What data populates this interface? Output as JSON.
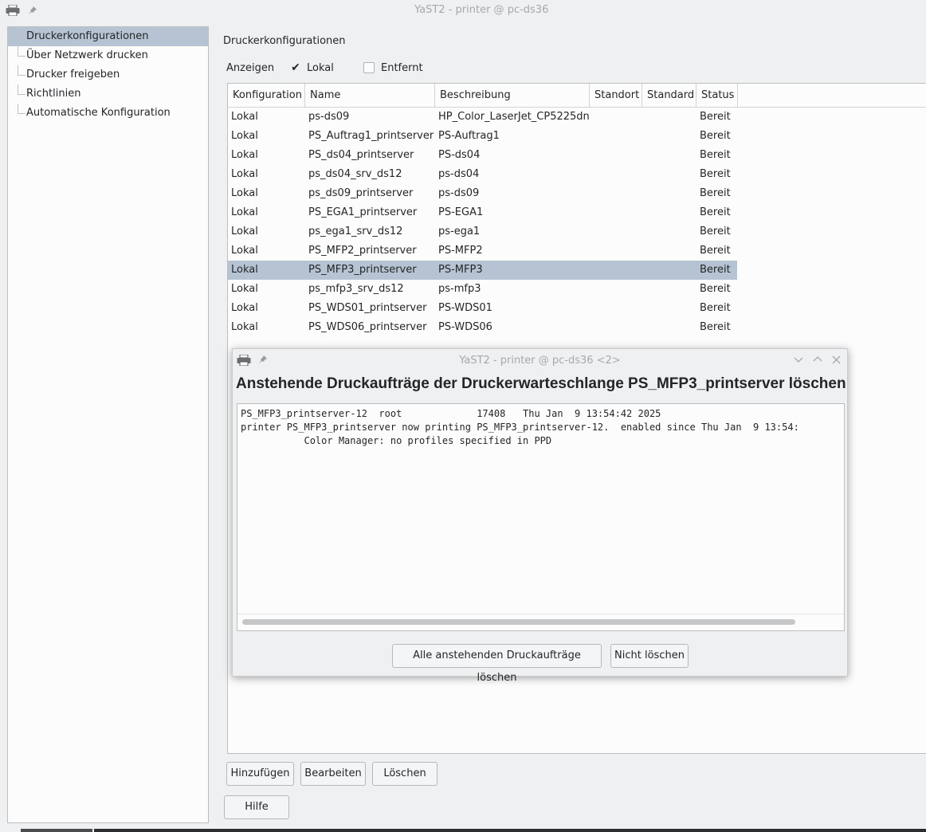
{
  "window": {
    "title": "YaST2 - printer @ pc-ds36"
  },
  "sidebar": {
    "items": [
      {
        "label": "Druckerkonfigurationen",
        "selected": true
      },
      {
        "label": "Über Netzwerk drucken",
        "selected": false
      },
      {
        "label": "Drucker freigeben",
        "selected": false
      },
      {
        "label": "Richtlinien",
        "selected": false
      },
      {
        "label": "Automatische Konfiguration",
        "selected": false
      }
    ]
  },
  "main": {
    "heading": "Druckerkonfigurationen",
    "show_label": "Anzeigen",
    "filter_local": {
      "label": "Lokal",
      "checked": true
    },
    "filter_remote": {
      "label": "Entfernt",
      "checked": false
    },
    "columns": [
      "Konfiguration",
      "Name",
      "Beschreibung",
      "Standort",
      "Standard",
      "Status"
    ],
    "rows": [
      [
        "Lokal",
        "ps-ds09",
        "HP_Color_LaserJet_CP5225dn",
        "",
        "",
        "Bereit"
      ],
      [
        "Lokal",
        "PS_Auftrag1_printserver",
        "PS-Auftrag1",
        "",
        "",
        "Bereit"
      ],
      [
        "Lokal",
        "PS_ds04_printserver",
        "PS-ds04",
        "",
        "",
        "Bereit"
      ],
      [
        "Lokal",
        "ps_ds04_srv_ds12",
        "ps-ds04",
        "",
        "",
        "Bereit"
      ],
      [
        "Lokal",
        "ps_ds09_printserver",
        "ps-ds09",
        "",
        "",
        "Bereit"
      ],
      [
        "Lokal",
        "PS_EGA1_printserver",
        "PS-EGA1",
        "",
        "",
        "Bereit"
      ],
      [
        "Lokal",
        "ps_ega1_srv_ds12",
        "ps-ega1",
        "",
        "",
        "Bereit"
      ],
      [
        "Lokal",
        "PS_MFP2_printserver",
        "PS-MFP2",
        "",
        "",
        "Bereit"
      ],
      [
        "Lokal",
        "PS_MFP3_printserver",
        "PS-MFP3",
        "",
        "",
        "Bereit"
      ],
      [
        "Lokal",
        "ps_mfp3_srv_ds12",
        "ps-mfp3",
        "",
        "",
        "Bereit"
      ],
      [
        "Lokal",
        "PS_WDS01_printserver",
        "PS-WDS01",
        "",
        "",
        "Bereit"
      ],
      [
        "Lokal",
        "PS_WDS06_printserver",
        "PS-WDS06",
        "",
        "",
        "Bereit"
      ]
    ],
    "selected_row": 8,
    "buttons": {
      "add": "Hinzufügen",
      "edit": "Bearbeiten",
      "delete": "Löschen",
      "help": "Hilfe"
    }
  },
  "dialog": {
    "title": "YaST2 - printer @ pc-ds36 <2>",
    "heading": "Anstehende Druckaufträge der Druckerwarteschlange PS_MFP3_printserver löschen",
    "log_lines": [
      "PS_MFP3_printserver-12  root             17408   Thu Jan  9 13:54:42 2025",
      "printer PS_MFP3_printserver now printing PS_MFP3_printserver-12.  enabled since Thu Jan  9 13:54:",
      "           Color Manager: no profiles specified in PPD"
    ],
    "buttons": {
      "delete_all": "Alle anstehenden Druckaufträge löschen",
      "dont_delete": "Nicht löschen"
    }
  },
  "icons": {
    "app": "printer-icon",
    "pin": "pin-icon",
    "minimize": "minimize-icon",
    "maximize": "maximize-icon",
    "close": "close-icon",
    "check": "checkmark-icon"
  }
}
